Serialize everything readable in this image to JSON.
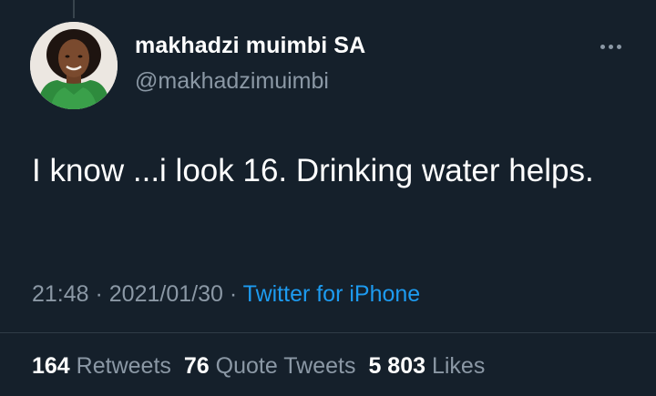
{
  "author": {
    "display_name": "makhadzi muimbi SA",
    "handle": "@makhadzimuimbi",
    "avatar_icon": "profile-photo"
  },
  "more_icon": "ellipsis-icon",
  "tweet": {
    "text": "I know ...i look 16. Drinking water helps."
  },
  "meta": {
    "time": "21:48",
    "separator": " · ",
    "date": "2021/01/30",
    "source": "Twitter for iPhone"
  },
  "stats": {
    "retweets": {
      "count": "164",
      "label": "Retweets"
    },
    "quote_tweets": {
      "count": "76",
      "label": "Quote Tweets"
    },
    "likes": {
      "count": "5 803",
      "label": "Likes"
    }
  },
  "colors": {
    "background": "#15202b",
    "primary_text": "#ffffff",
    "secondary_text": "#8b98a5",
    "link": "#1d9bf0"
  }
}
